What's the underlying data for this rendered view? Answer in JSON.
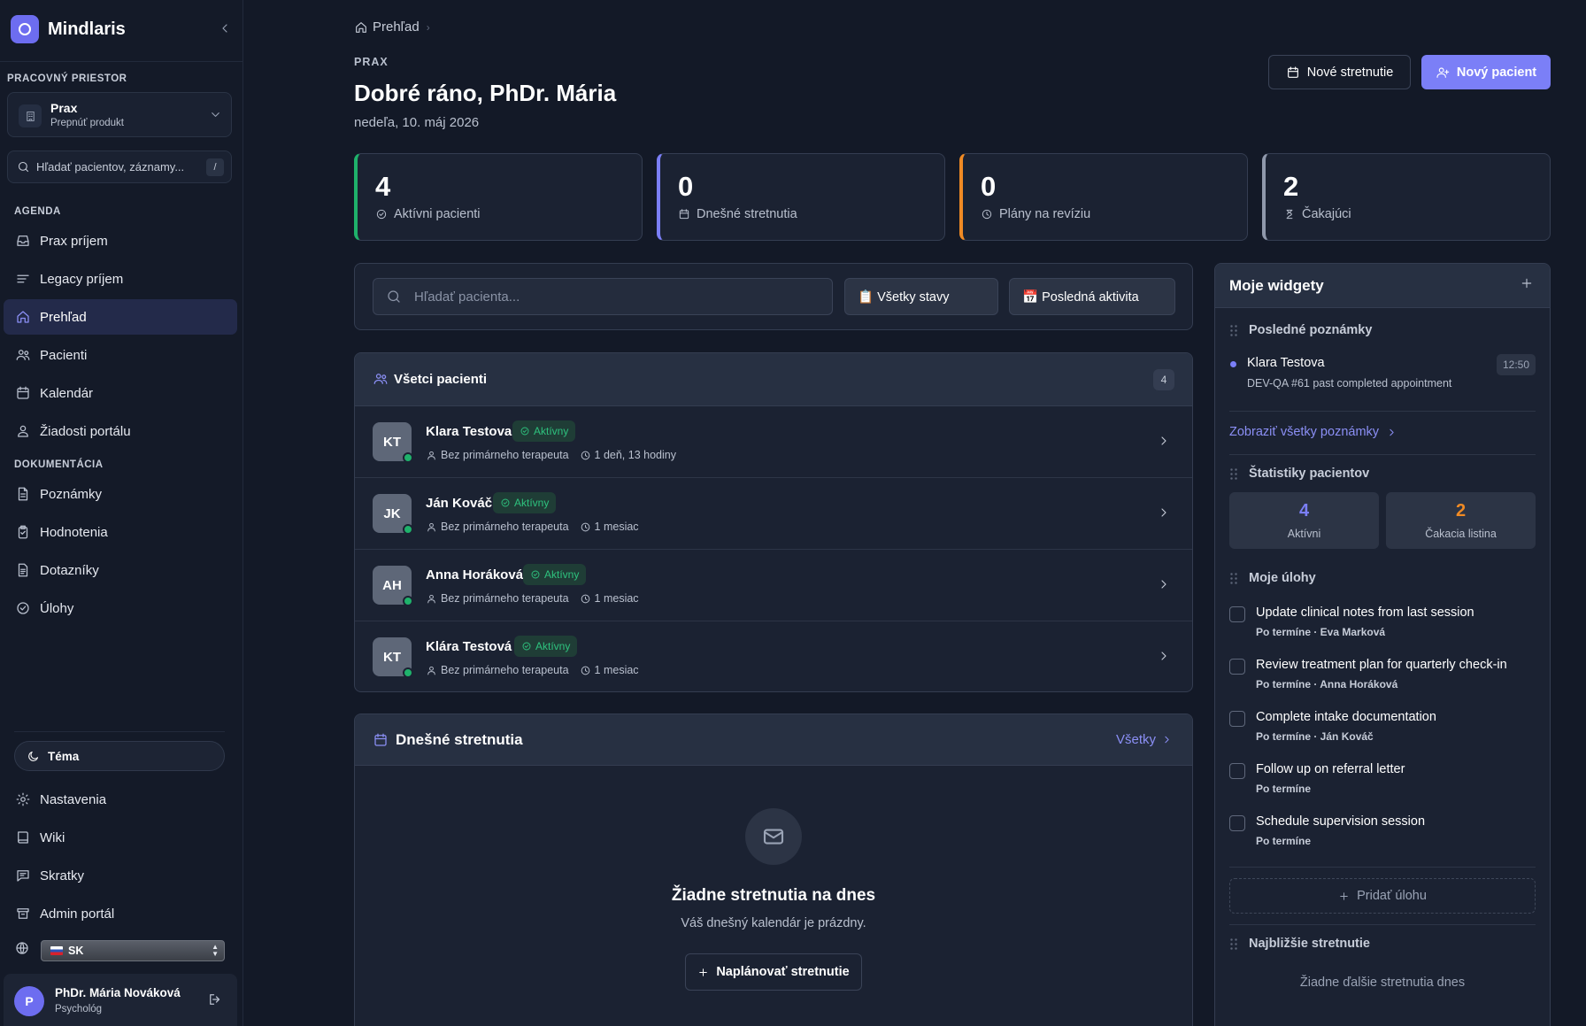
{
  "app": {
    "name": "Mindlaris"
  },
  "sidebar": {
    "workspace_label": "PRACOVNÝ PRIESTOR",
    "workspace": {
      "title": "Prax",
      "subtitle": "Prepnúť produkt"
    },
    "search": {
      "placeholder": "Hľadať pacientov, záznamy...",
      "shortcut": "/"
    },
    "agenda_label": "AGENDA",
    "agenda_items": [
      {
        "label": "Prax príjem",
        "icon": "inbox-icon"
      },
      {
        "label": "Legacy príjem",
        "icon": "lines-icon"
      },
      {
        "label": "Prehľad",
        "icon": "home-icon",
        "active": true
      },
      {
        "label": "Pacienti",
        "icon": "users-icon"
      },
      {
        "label": "Kalendár",
        "icon": "calendar-icon"
      },
      {
        "label": "Žiadosti portálu",
        "icon": "user-icon"
      }
    ],
    "docs_label": "DOKUMENTÁCIA",
    "docs_items": [
      {
        "label": "Poznámky",
        "icon": "file-icon"
      },
      {
        "label": "Hodnotenia",
        "icon": "clipboard-icon"
      },
      {
        "label": "Dotazníky",
        "icon": "file-list-icon"
      },
      {
        "label": "Úlohy",
        "icon": "check-circle-icon"
      }
    ],
    "theme_label": "Téma",
    "bottom_items": [
      {
        "label": "Nastavenia",
        "icon": "gear-icon"
      },
      {
        "label": "Wiki",
        "icon": "book-icon"
      },
      {
        "label": "Skratky",
        "icon": "message-icon"
      },
      {
        "label": "Admin portál",
        "icon": "archive-icon"
      }
    ],
    "language": "SK",
    "user": {
      "initial": "P",
      "name": "PhDr. Mária Nováková",
      "role": "Psychológ"
    }
  },
  "header": {
    "breadcrumb": "Prehľad",
    "section": "PRAX",
    "title": "Dobré ráno, PhDr. Mária",
    "date": "nedeľa, 10. máj 2026",
    "new_meeting": "Nové stretnutie",
    "new_patient": "Nový pacient"
  },
  "stats": [
    {
      "value": "4",
      "label": "Aktívni pacienti",
      "icon": "check-circle-icon",
      "color": "#1fb26b"
    },
    {
      "value": "0",
      "label": "Dnešné stretnutia",
      "icon": "calendar-icon",
      "color": "#7b7ff7"
    },
    {
      "value": "0",
      "label": "Plány na revíziu",
      "icon": "clock-icon",
      "color": "#f08a24"
    },
    {
      "value": "2",
      "label": "Čakajúci",
      "icon": "hourglass-icon",
      "color": "#8f98ab"
    }
  ],
  "filters": {
    "search_placeholder": "Hľadať pacienta...",
    "status": "📋 Všetky stavy",
    "sort": "📅 Posledná aktivita"
  },
  "patients": {
    "title": "Všetci pacienti",
    "count": "4",
    "rows": [
      {
        "initials": "KT",
        "name": "Klara Testova",
        "status": "Aktívny",
        "therapist": "Bez primárneho terapeuta",
        "activity": "1 deň, 13 hodiny"
      },
      {
        "initials": "JK",
        "name": "Ján Kováč",
        "status": "Aktívny",
        "therapist": "Bez primárneho terapeuta",
        "activity": "1 mesiac"
      },
      {
        "initials": "AH",
        "name": "Anna Horáková",
        "status": "Aktívny",
        "therapist": "Bez primárneho terapeuta",
        "activity": "1 mesiac"
      },
      {
        "initials": "KT",
        "name": "Klára Testová",
        "status": "Aktívny",
        "therapist": "Bez primárneho terapeuta",
        "activity": "1 mesiac"
      }
    ]
  },
  "today": {
    "title": "Dnešné stretnutia",
    "all_label": "Všetky",
    "empty_title": "Žiadne stretnutia na dnes",
    "empty_sub": "Váš dnešný kalendár je prázdny.",
    "schedule_label": "Naplánovať stretnutie"
  },
  "widgets": {
    "title": "Moje widgety",
    "notes_title": "Posledné poznámky",
    "note": {
      "name": "Klara Testova",
      "sub": "DEV-QA #61 past completed appointment",
      "time": "12:50"
    },
    "notes_link": "Zobraziť všetky poznámky",
    "stats_title": "Štatistiky pacientov",
    "patient_stats": [
      {
        "value": "4",
        "label": "Aktívni",
        "color": "#7b7ff7"
      },
      {
        "value": "2",
        "label": "Čakacia listina",
        "color": "#f08a24"
      }
    ],
    "tasks_title": "Moje úlohy",
    "tasks": [
      {
        "title": "Update clinical notes from last session",
        "meta": "Po termíne · Eva Marková"
      },
      {
        "title": "Review treatment plan for quarterly check-in",
        "meta": "Po termíne · Anna Horáková"
      },
      {
        "title": "Complete intake documentation",
        "meta": "Po termíne · Ján Kováč"
      },
      {
        "title": "Follow up on referral letter",
        "meta": "Po termíne"
      },
      {
        "title": "Schedule supervision session",
        "meta": "Po termíne"
      }
    ],
    "add_task": "Pridať úlohu",
    "upcoming_title": "Najbližšie stretnutie",
    "upcoming_empty": "Žiadne ďalšie stretnutia dnes"
  }
}
